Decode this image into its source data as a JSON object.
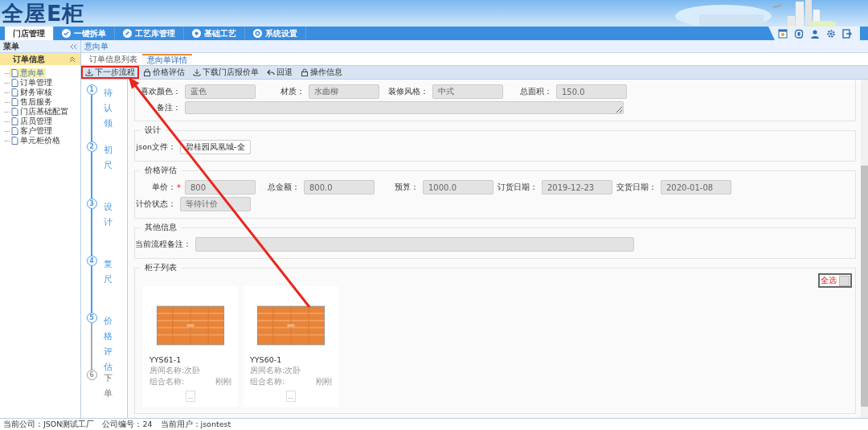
{
  "header": {
    "logo": "全屋E柜"
  },
  "nav": {
    "tabs": [
      {
        "label": "门店管理",
        "selected": true
      },
      {
        "label": "一键拆单",
        "selected": false
      },
      {
        "label": "工艺库管理",
        "selected": false
      },
      {
        "label": "基础工艺",
        "selected": false
      },
      {
        "label": "系统设置",
        "selected": false
      }
    ],
    "tools": [
      {
        "kind": "window"
      },
      {
        "kind": "refresh"
      },
      {
        "kind": "user"
      },
      {
        "kind": "settings"
      },
      {
        "kind": "exit"
      }
    ]
  },
  "sidebar": {
    "title": "菜单",
    "group": {
      "label": "订单信息",
      "expanded": true
    },
    "items": [
      {
        "label": "意向单",
        "selected": true
      },
      {
        "label": "订单管理",
        "selected": false
      },
      {
        "label": "财务审核",
        "selected": false
      },
      {
        "label": "售后服务",
        "selected": false
      },
      {
        "label": "门店基础配置",
        "selected": false
      },
      {
        "label": "店员管理",
        "selected": false
      },
      {
        "label": "客户管理",
        "selected": false
      },
      {
        "label": "单元柜价格",
        "selected": false
      }
    ]
  },
  "breadcrumb": "意向单",
  "tabs": [
    {
      "label": "订单信息列表",
      "selected": false
    },
    {
      "label": "意向单详情",
      "selected": true
    }
  ],
  "toolbar": [
    {
      "label": "下一步流程",
      "highlighted": true
    },
    {
      "label": "价格评估",
      "highlighted": false
    },
    {
      "label": "下载门店报价单",
      "highlighted": false
    },
    {
      "label": "回退",
      "highlighted": false
    },
    {
      "label": "操作信息",
      "highlighted": false
    }
  ],
  "steps": [
    {
      "number": "1",
      "label": "待认领",
      "done": true
    },
    {
      "number": "2",
      "label": "初尺",
      "done": true
    },
    {
      "number": "3",
      "label": "设计",
      "done": true
    },
    {
      "number": "4",
      "label": "复尺",
      "done": true
    },
    {
      "number": "5",
      "label": "价格评估",
      "done": true
    },
    {
      "number": "6",
      "label": "下单",
      "done": false
    }
  ],
  "sections": [
    {
      "rows": [
        [
          {
            "label": "喜欢颜色：",
            "value": "蓝色",
            "kind": "input",
            "readonly": true
          },
          {
            "label": "材质：",
            "value": "水曲柳",
            "kind": "input",
            "readonly": true
          },
          {
            "label": "装修风格：",
            "value": "中式",
            "kind": "input",
            "readonly": true
          },
          {
            "label": "总面积：",
            "value": "150.0",
            "kind": "input",
            "readonly": true
          }
        ],
        [
          {
            "label": "备注：",
            "kind": "textarea",
            "readonly": true
          }
        ]
      ]
    },
    {
      "title": "设计",
      "rows": [
        [
          {
            "label": "json文件：",
            "value": "碧桂园凤凰城-全",
            "kind": "input",
            "readonly": false
          }
        ]
      ]
    },
    {
      "title": "价格评估",
      "rows": [
        [
          {
            "label": "单价：",
            "required_mark": "*",
            "value": "800",
            "kind": "input",
            "readonly": true
          },
          {
            "label": "总金额：",
            "value": "800.0",
            "kind": "input",
            "readonly": true
          },
          {
            "label": "预算：",
            "value": "1000.0",
            "kind": "input",
            "readonly": true
          },
          {
            "label": "订货日期：",
            "value": "2019-12-23",
            "kind": "input",
            "readonly": true
          },
          {
            "label": "交货日期：",
            "value": "2020-01-08",
            "kind": "input",
            "readonly": true
          }
        ],
        [
          {
            "label": "计价状态：",
            "value": "等待计价",
            "kind": "input",
            "readonly": true
          }
        ]
      ]
    },
    {
      "title": "其他信息",
      "rows": [
        [
          {
            "label": "当前流程备注：",
            "kind": "wide",
            "readonly": true
          }
        ]
      ]
    }
  ],
  "cabinets": {
    "title": "柜子列表",
    "select_all": {
      "label": "全选"
    },
    "cards": [
      {
        "code": "YYS61-1",
        "room": "房间名称:次卧",
        "group_label": "组合名称:",
        "group_value": "刚刚",
        "action": "..."
      },
      {
        "code": "YYS60-1",
        "room": "房间名称:次卧",
        "group_label": "组合名称:",
        "group_value": "刚刚",
        "action": "..."
      }
    ]
  },
  "status_bar": [
    "当前公司：JSON测试工厂",
    "公司编号：24",
    "当前用户：jsontest"
  ]
}
